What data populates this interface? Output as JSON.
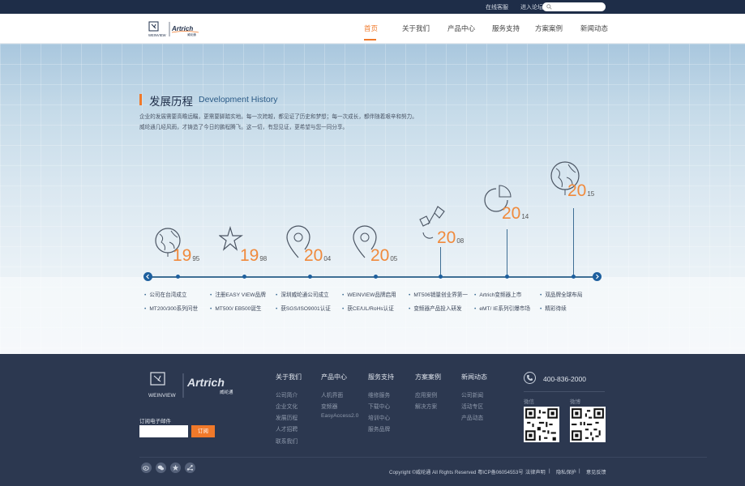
{
  "topbar": {
    "service_link": "在线客服",
    "forum_link": "进入论坛",
    "search_placeholder": ""
  },
  "brand": {
    "logo_left": "WEINVIEW",
    "logo_right": "Artrich",
    "logo_cn": "威纶通"
  },
  "nav": {
    "items": [
      {
        "label": "首页",
        "active": true
      },
      {
        "label": "关于我们"
      },
      {
        "label": "产品中心"
      },
      {
        "label": "服务支持"
      },
      {
        "label": "方案案例"
      },
      {
        "label": "新闻动态"
      }
    ]
  },
  "section": {
    "title": "发展历程",
    "subtitle": "Development History",
    "description": "企业的发展需要高瞻远瞩，更需要脚踏实地。每一次跨越，都见证了历史和梦想；每一次成长，都伴随着艰辛和努力。威纶通几经风雨，才铸造了今日的鹏程腾飞。这一切，有您见证，更希望与您一同分享。"
  },
  "timeline": {
    "milestones": [
      {
        "year_big": "19",
        "year_small": "95",
        "icon": "globe-icon",
        "events": [
          "公司在台湾成立",
          "MT200/300系列问世"
        ]
      },
      {
        "year_big": "19",
        "year_small": "98",
        "icon": "star-icon",
        "events": [
          "注册EASY VIEW品牌",
          "MT500/ EB500诞生"
        ]
      },
      {
        "year_big": "20",
        "year_small": "04",
        "icon": "location-pin-icon",
        "events": [
          "深圳威纶通公司成立",
          "获SGS/ISO9001认证"
        ]
      },
      {
        "year_big": "20",
        "year_small": "05",
        "icon": "location-pin-icon",
        "events": [
          "WEINVIEW品牌启用",
          "获CE/UL/RoHs认证"
        ]
      },
      {
        "year_big": "20",
        "year_small": "08",
        "icon": "satellite-icon",
        "events": [
          "MT506销量创业界第一",
          "变频器产品投入研发"
        ]
      },
      {
        "year_big": "20",
        "year_small": "14",
        "icon": "pie-chart-icon",
        "events": [
          "Artrich变频器上市",
          "eMT/ IE系列引爆市场"
        ]
      },
      {
        "year_big": "20",
        "year_small": "15",
        "icon": "globe-icon",
        "events": [
          "双品牌全球布局",
          "精彩待续"
        ]
      }
    ]
  },
  "footer": {
    "columns": [
      {
        "title": "关于我们",
        "items": [
          "公司简介",
          "企业文化",
          "发展历程",
          "人才招聘",
          "联系我们"
        ]
      },
      {
        "title": "产品中心",
        "items": [
          "人机界面",
          "变频器",
          "EasyAccess2.0"
        ]
      },
      {
        "title": "服务支持",
        "items": [
          "维修服务",
          "下载中心",
          "培训中心",
          "服务品牌"
        ]
      },
      {
        "title": "方案案例",
        "items": [
          "应用案例",
          "解决方案"
        ]
      },
      {
        "title": "新闻动态",
        "items": [
          "公司新闻",
          "活动专区",
          "产品动态"
        ]
      }
    ],
    "subscribe_label": "订阅电子邮件",
    "subscribe_button": "订阅",
    "phone": "400-836-2000",
    "qr_wechat_label": "微信",
    "qr_weibo_label": "微博",
    "copyright": "Copyright ©威纶通 All Rights Reserved 粤ICP备06054553号",
    "links": [
      "法律声明",
      "隐私保护",
      "意见反馈"
    ],
    "social_icons": [
      "weibo-icon",
      "wechat-icon",
      "star-icon",
      "share-icon"
    ]
  },
  "colors": {
    "accent": "#f0792a",
    "navy": "#1e2d48",
    "footer_bg": "#2c3850",
    "timeline": "#3f6f95"
  }
}
